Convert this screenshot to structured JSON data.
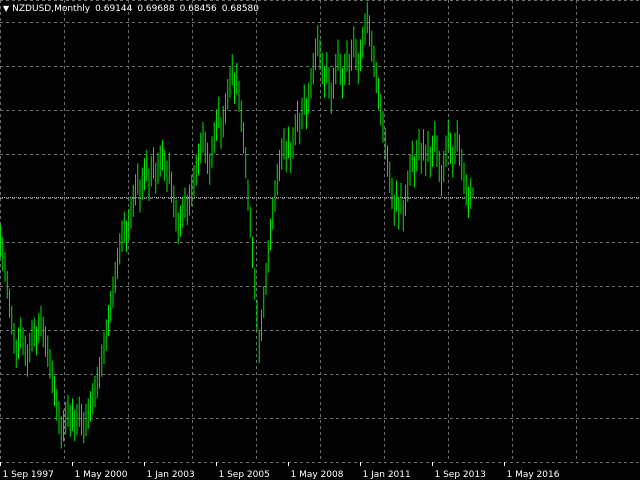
{
  "info": {
    "collapse_icon": "triangle-down-icon",
    "symbol": "NZDUSD,Monthly",
    "open": "0.69144",
    "high": "0.69688",
    "low": "0.68456",
    "close": "0.68580"
  },
  "colors": {
    "background": "#000000",
    "bars": "#00e600",
    "grid": "#6f6f6f",
    "bid_line": "#9aa0a8",
    "text": "#ffffff"
  },
  "chart_data": {
    "type": "ohlc",
    "symbol": "NZDUSD",
    "timeframe": "Monthly",
    "grid": true,
    "ylim": [
      0.39,
      0.905
    ],
    "bid_line": 0.6858,
    "x_tick_labels": [
      "1 Sep 1997",
      "1 May 2000",
      "1 Jan 2003",
      "1 Sep 2005",
      "1 May 2008",
      "1 Jan 2011",
      "1 Sep 2013",
      "1 May 2016"
    ],
    "x_tick_index": [
      0,
      32,
      64,
      96,
      128,
      160,
      192,
      224
    ],
    "bars": [
      [
        0.618,
        0.654
      ],
      [
        0.603,
        0.641
      ],
      [
        0.591,
        0.624
      ],
      [
        0.572,
        0.603
      ],
      [
        0.551,
        0.583
      ],
      [
        0.532,
        0.564
      ],
      [
        0.511,
        0.545
      ],
      [
        0.495,
        0.526
      ],
      [
        0.505,
        0.54
      ],
      [
        0.517,
        0.551
      ],
      [
        0.509,
        0.54
      ],
      [
        0.497,
        0.531
      ],
      [
        0.485,
        0.521
      ],
      [
        0.501,
        0.534
      ],
      [
        0.513,
        0.548
      ],
      [
        0.519,
        0.551
      ],
      [
        0.509,
        0.541
      ],
      [
        0.523,
        0.556
      ],
      [
        0.53,
        0.564
      ],
      [
        0.518,
        0.552
      ],
      [
        0.507,
        0.541
      ],
      [
        0.496,
        0.531
      ],
      [
        0.483,
        0.516
      ],
      [
        0.467,
        0.503
      ],
      [
        0.452,
        0.486
      ],
      [
        0.436,
        0.471
      ],
      [
        0.421,
        0.458
      ],
      [
        0.405,
        0.441
      ],
      [
        0.413,
        0.448
      ],
      [
        0.421,
        0.457
      ],
      [
        0.429,
        0.465
      ],
      [
        0.418,
        0.454
      ],
      [
        0.425,
        0.461
      ],
      [
        0.413,
        0.448
      ],
      [
        0.42,
        0.455
      ],
      [
        0.429,
        0.463
      ],
      [
        0.42,
        0.455
      ],
      [
        0.411,
        0.446
      ],
      [
        0.419,
        0.455
      ],
      [
        0.427,
        0.461
      ],
      [
        0.435,
        0.469
      ],
      [
        0.443,
        0.478
      ],
      [
        0.451,
        0.486
      ],
      [
        0.461,
        0.496
      ],
      [
        0.472,
        0.507
      ],
      [
        0.485,
        0.521
      ],
      [
        0.499,
        0.535
      ],
      [
        0.514,
        0.549
      ],
      [
        0.53,
        0.565
      ],
      [
        0.546,
        0.581
      ],
      [
        0.562,
        0.597
      ],
      [
        0.578,
        0.613
      ],
      [
        0.594,
        0.629
      ],
      [
        0.61,
        0.645
      ],
      [
        0.624,
        0.659
      ],
      [
        0.634,
        0.669
      ],
      [
        0.624,
        0.659
      ],
      [
        0.637,
        0.672
      ],
      [
        0.65,
        0.686
      ],
      [
        0.663,
        0.699
      ],
      [
        0.676,
        0.711
      ],
      [
        0.688,
        0.723
      ],
      [
        0.668,
        0.705
      ],
      [
        0.682,
        0.718
      ],
      [
        0.693,
        0.729
      ],
      [
        0.703,
        0.738
      ],
      [
        0.681,
        0.717
      ],
      [
        0.697,
        0.731
      ],
      [
        0.706,
        0.741
      ],
      [
        0.689,
        0.724
      ],
      [
        0.7,
        0.735
      ],
      [
        0.708,
        0.743
      ],
      [
        0.715,
        0.749
      ],
      [
        0.703,
        0.738
      ],
      [
        0.691,
        0.726
      ],
      [
        0.7,
        0.735
      ],
      [
        0.679,
        0.714
      ],
      [
        0.663,
        0.698
      ],
      [
        0.647,
        0.682
      ],
      [
        0.633,
        0.668
      ],
      [
        0.641,
        0.676
      ],
      [
        0.651,
        0.686
      ],
      [
        0.662,
        0.696
      ],
      [
        0.654,
        0.688
      ],
      [
        0.665,
        0.699
      ],
      [
        0.675,
        0.71
      ],
      [
        0.686,
        0.721
      ],
      [
        0.698,
        0.733
      ],
      [
        0.71,
        0.745
      ],
      [
        0.723,
        0.757
      ],
      [
        0.735,
        0.769
      ],
      [
        0.723,
        0.758
      ],
      [
        0.711,
        0.746
      ],
      [
        0.699,
        0.734
      ],
      [
        0.718,
        0.753
      ],
      [
        0.734,
        0.769
      ],
      [
        0.748,
        0.783
      ],
      [
        0.762,
        0.797
      ],
      [
        0.739,
        0.774
      ],
      [
        0.752,
        0.787
      ],
      [
        0.767,
        0.801
      ],
      [
        0.783,
        0.817
      ],
      [
        0.796,
        0.831
      ],
      [
        0.81,
        0.845
      ],
      [
        0.789,
        0.824
      ],
      [
        0.8,
        0.835
      ],
      [
        0.78,
        0.815
      ],
      [
        0.758,
        0.793
      ],
      [
        0.734,
        0.769
      ],
      [
        0.706,
        0.741
      ],
      [
        0.67,
        0.705
      ],
      [
        0.64,
        0.675
      ],
      [
        0.606,
        0.641
      ],
      [
        0.571,
        0.606
      ],
      [
        0.536,
        0.571
      ],
      [
        0.5,
        0.536
      ],
      [
        0.525,
        0.56
      ],
      [
        0.551,
        0.586
      ],
      [
        0.576,
        0.612
      ],
      [
        0.601,
        0.637
      ],
      [
        0.626,
        0.661
      ],
      [
        0.649,
        0.684
      ],
      [
        0.669,
        0.704
      ],
      [
        0.687,
        0.722
      ],
      [
        0.703,
        0.738
      ],
      [
        0.716,
        0.751
      ],
      [
        0.727,
        0.762
      ],
      [
        0.713,
        0.748
      ],
      [
        0.729,
        0.764
      ],
      [
        0.712,
        0.747
      ],
      [
        0.728,
        0.763
      ],
      [
        0.743,
        0.778
      ],
      [
        0.758,
        0.793
      ],
      [
        0.744,
        0.779
      ],
      [
        0.761,
        0.796
      ],
      [
        0.777,
        0.811
      ],
      [
        0.761,
        0.796
      ],
      [
        0.778,
        0.813
      ],
      [
        0.795,
        0.829
      ],
      [
        0.811,
        0.846
      ],
      [
        0.827,
        0.862
      ],
      [
        0.842,
        0.877
      ],
      [
        0.827,
        0.861
      ],
      [
        0.811,
        0.846
      ],
      [
        0.796,
        0.831
      ],
      [
        0.812,
        0.847
      ],
      [
        0.795,
        0.83
      ],
      [
        0.778,
        0.813
      ],
      [
        0.795,
        0.83
      ],
      [
        0.811,
        0.845
      ],
      [
        0.826,
        0.861
      ],
      [
        0.81,
        0.845
      ],
      [
        0.795,
        0.829
      ],
      [
        0.81,
        0.845
      ],
      [
        0.825,
        0.86
      ],
      [
        0.81,
        0.845
      ],
      [
        0.826,
        0.861
      ],
      [
        0.841,
        0.876
      ],
      [
        0.827,
        0.862
      ],
      [
        0.811,
        0.846
      ],
      [
        0.826,
        0.861
      ],
      [
        0.84,
        0.875
      ],
      [
        0.855,
        0.89
      ],
      [
        0.868,
        0.903
      ],
      [
        0.853,
        0.888
      ],
      [
        0.836,
        0.871
      ],
      [
        0.819,
        0.854
      ],
      [
        0.801,
        0.836
      ],
      [
        0.783,
        0.818
      ],
      [
        0.765,
        0.8
      ],
      [
        0.746,
        0.781
      ],
      [
        0.727,
        0.762
      ],
      [
        0.708,
        0.743
      ],
      [
        0.69,
        0.725
      ],
      [
        0.672,
        0.707
      ],
      [
        0.653,
        0.688
      ],
      [
        0.669,
        0.704
      ],
      [
        0.649,
        0.684
      ],
      [
        0.666,
        0.701
      ],
      [
        0.647,
        0.682
      ],
      [
        0.664,
        0.699
      ],
      [
        0.68,
        0.715
      ],
      [
        0.698,
        0.733
      ],
      [
        0.713,
        0.748
      ],
      [
        0.696,
        0.731
      ],
      [
        0.714,
        0.749
      ],
      [
        0.726,
        0.761
      ],
      [
        0.711,
        0.746
      ],
      [
        0.726,
        0.761
      ],
      [
        0.709,
        0.744
      ],
      [
        0.724,
        0.759
      ],
      [
        0.707,
        0.742
      ],
      [
        0.719,
        0.754
      ],
      [
        0.735,
        0.77
      ],
      [
        0.719,
        0.754
      ],
      [
        0.702,
        0.737
      ],
      [
        0.686,
        0.721
      ],
      [
        0.702,
        0.737
      ],
      [
        0.719,
        0.754
      ],
      [
        0.737,
        0.772
      ],
      [
        0.722,
        0.757
      ],
      [
        0.707,
        0.742
      ],
      [
        0.722,
        0.757
      ],
      [
        0.736,
        0.771
      ],
      [
        0.72,
        0.755
      ],
      [
        0.704,
        0.739
      ],
      [
        0.689,
        0.724
      ],
      [
        0.676,
        0.711
      ],
      [
        0.662,
        0.697
      ],
      [
        0.672,
        0.707
      ],
      [
        0.684,
        0.696
      ]
    ]
  }
}
